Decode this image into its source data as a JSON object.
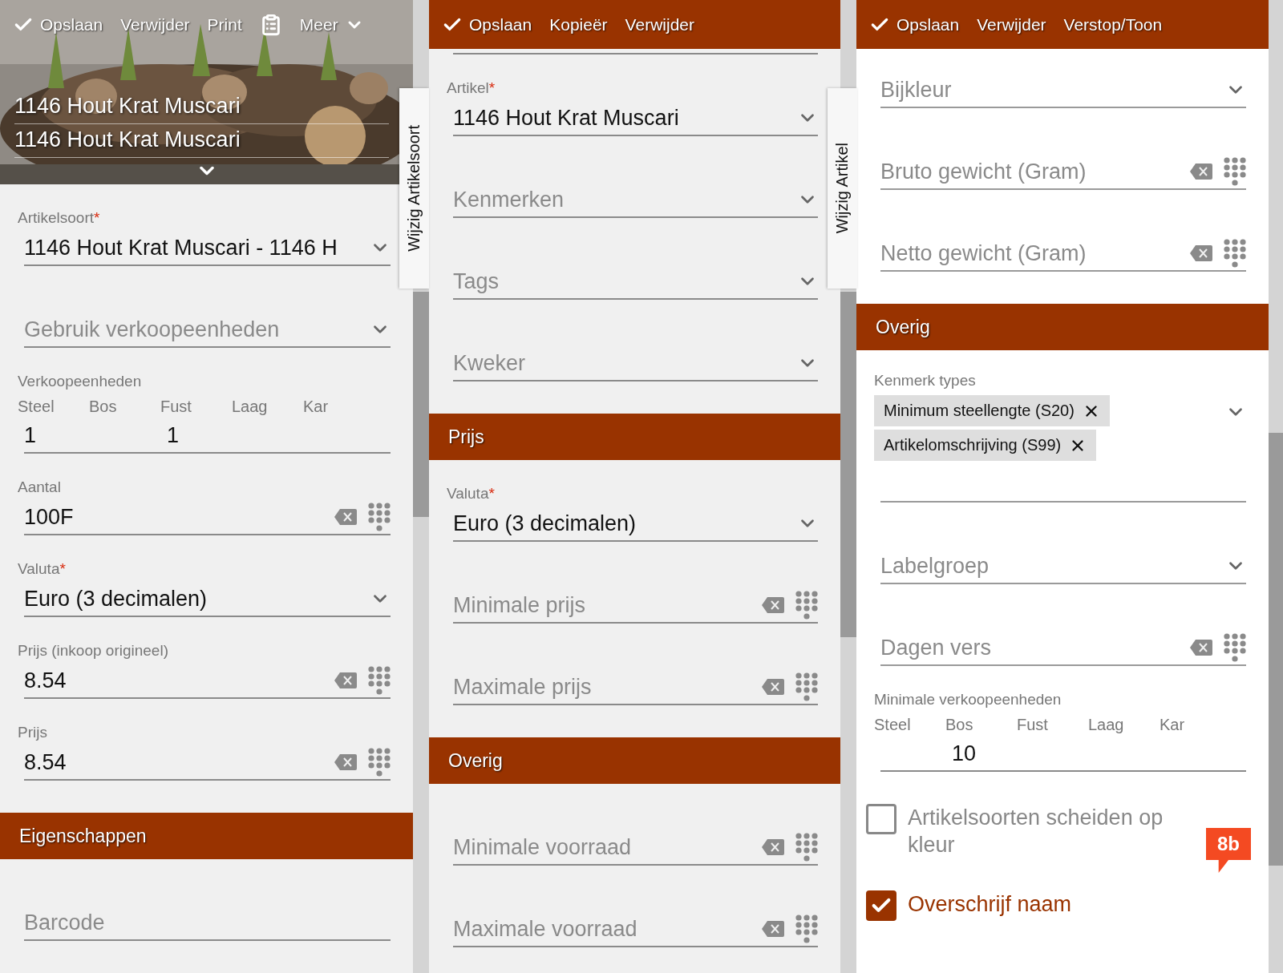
{
  "panels": [
    {
      "toolbar": [
        {
          "kind": "save",
          "label": "Opslaan"
        },
        {
          "kind": "action",
          "label": "Verwijder"
        },
        {
          "kind": "action",
          "label": "Print"
        },
        {
          "kind": "clipboard"
        },
        {
          "kind": "menu",
          "label": "Meer"
        }
      ],
      "header": {
        "kind": "picture",
        "titles": [
          "1146 Hout Krat Muscari",
          "1146 Hout Krat Muscari"
        ]
      },
      "side_tab": "Wijzig Artikelsoort",
      "items": [
        {
          "kind": "select",
          "label": "Artikelsoort",
          "required_mark": "*",
          "value": "1146 Hout Krat Muscari - 1146 H"
        },
        {
          "kind": "select",
          "placeholder": "Gebruik verkoopeenheden"
        },
        {
          "kind": "units",
          "label": "Verkoopeenheden",
          "columns": [
            {
              "label": "Steel",
              "value": "1"
            },
            {
              "label": "Bos"
            },
            {
              "label": "Fust",
              "value": "1"
            },
            {
              "label": "Laag"
            },
            {
              "label": "Kar"
            }
          ]
        },
        {
          "kind": "number",
          "label": "Aantal",
          "value": "100F"
        },
        {
          "kind": "select",
          "label": "Valuta",
          "required_mark": "*",
          "value": "Euro (3 decimalen)"
        },
        {
          "kind": "number",
          "label": "Prijs (inkoop origineel)",
          "value": "8.54"
        },
        {
          "kind": "number",
          "label": "Prijs",
          "value": "8.54"
        },
        {
          "kind": "section",
          "title": "Eigenschappen"
        },
        {
          "kind": "text",
          "placeholder": "Barcode"
        }
      ]
    },
    {
      "toolbar": [
        {
          "kind": "save",
          "label": "Opslaan"
        },
        {
          "kind": "action",
          "label": "Kopieër"
        },
        {
          "kind": "action",
          "label": "Verwijder"
        }
      ],
      "side_tab": "Wijzig Artikel",
      "items": [
        {
          "kind": "select",
          "label": "Artikel",
          "required_mark": "*",
          "value": "1146 Hout Krat Muscari"
        },
        {
          "kind": "select",
          "placeholder": "Kenmerken"
        },
        {
          "kind": "select",
          "placeholder": "Tags"
        },
        {
          "kind": "select",
          "placeholder": "Kweker"
        },
        {
          "kind": "section",
          "title": "Prijs"
        },
        {
          "kind": "select",
          "label": "Valuta",
          "required_mark": "*",
          "value": "Euro (3 decimalen)"
        },
        {
          "kind": "number",
          "placeholder": "Minimale prijs"
        },
        {
          "kind": "number",
          "placeholder": "Maximale prijs"
        },
        {
          "kind": "section",
          "title": "Overig"
        },
        {
          "kind": "number",
          "placeholder": "Minimale voorraad"
        },
        {
          "kind": "number",
          "placeholder": "Maximale voorraad"
        }
      ]
    },
    {
      "toolbar": [
        {
          "kind": "save",
          "label": "Opslaan"
        },
        {
          "kind": "action",
          "label": "Verwijder"
        },
        {
          "kind": "action",
          "label": "Verstop/Toon"
        }
      ],
      "items": [
        {
          "kind": "select",
          "placeholder": "Bijkleur"
        },
        {
          "kind": "number",
          "placeholder": "Bruto gewicht (Gram)"
        },
        {
          "kind": "number",
          "placeholder": "Netto gewicht (Gram)"
        },
        {
          "kind": "section",
          "title": "Overig"
        },
        {
          "kind": "chips",
          "label": "Kenmerk types",
          "chips": [
            "Minimum steellengte (S20)",
            "Artikelomschrijving (S99)"
          ]
        },
        {
          "kind": "select",
          "placeholder": "Labelgroep"
        },
        {
          "kind": "number",
          "placeholder": "Dagen vers"
        },
        {
          "kind": "units",
          "label": "Minimale verkoopeenheden",
          "columns": [
            {
              "label": "Steel"
            },
            {
              "label": "Bos",
              "value": "10"
            },
            {
              "label": "Fust"
            },
            {
              "label": "Laag"
            },
            {
              "label": "Kar"
            }
          ]
        },
        {
          "kind": "checkbox",
          "label": "Artikelsoorten scheiden op kleur",
          "checked": false,
          "badge": "8b"
        },
        {
          "kind": "checkbox",
          "label": "Overschrijf naam",
          "checked": true
        }
      ]
    }
  ]
}
